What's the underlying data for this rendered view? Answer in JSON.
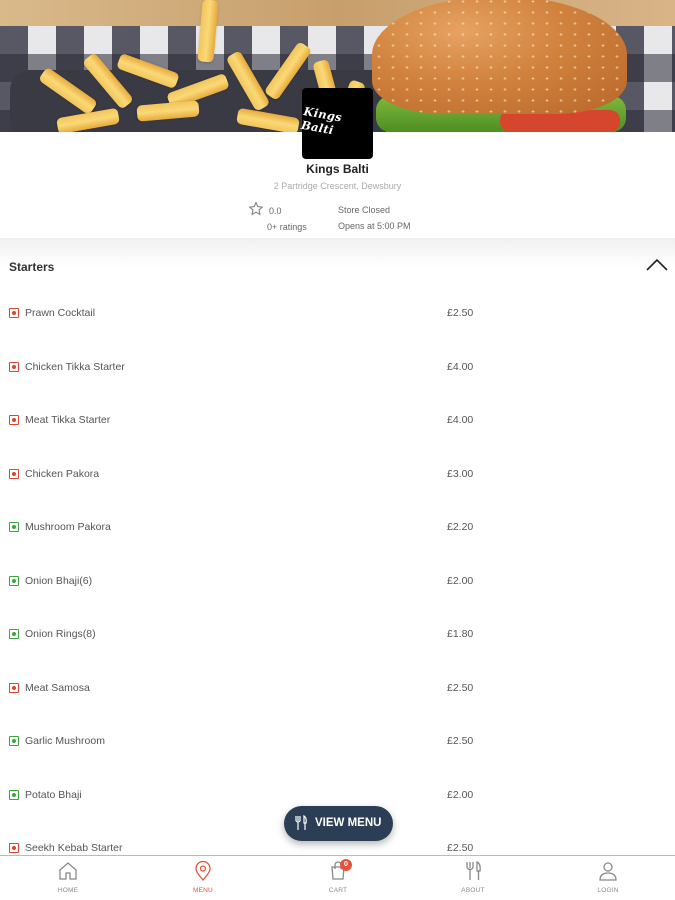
{
  "store": {
    "logo_text": "Kings Balti",
    "name": "Kings Balti",
    "address": "2 Partridge Crescent, Dewsbury",
    "rating": "0.0",
    "ratings_count": "0+ ratings",
    "status": "Store Closed",
    "hours": "Opens at 5:00 PM"
  },
  "section": {
    "title": "Starters",
    "expanded": true
  },
  "menu_items": [
    {
      "name": "Prawn Cocktail",
      "price": "£2.50",
      "diet": "non-veg"
    },
    {
      "name": "Chicken Tikka Starter",
      "price": "£4.00",
      "diet": "non-veg"
    },
    {
      "name": "Meat Tikka Starter",
      "price": "£4.00",
      "diet": "non-veg"
    },
    {
      "name": "Chicken Pakora",
      "price": "£3.00",
      "diet": "non-veg"
    },
    {
      "name": "Mushroom Pakora",
      "price": "£2.20",
      "diet": "veg"
    },
    {
      "name": "Onion Bhaji(6)",
      "price": "£2.00",
      "diet": "veg"
    },
    {
      "name": "Onion Rings(8)",
      "price": "£1.80",
      "diet": "veg"
    },
    {
      "name": "Meat Samosa",
      "price": "£2.50",
      "diet": "non-veg"
    },
    {
      "name": "Garlic Mushroom",
      "price": "£2.50",
      "diet": "veg"
    },
    {
      "name": "Potato Bhaji",
      "price": "£2.00",
      "diet": "veg"
    },
    {
      "name": "Seekh Kebab Starter",
      "price": "£2.50",
      "diet": "non-veg"
    }
  ],
  "view_menu_button": {
    "label": "VIEW MENU",
    "icon": "cutlery-icon"
  },
  "bottom_nav": {
    "home": {
      "label": "HOME",
      "icon": "home-icon"
    },
    "menu": {
      "label": "MENU",
      "icon": "location-pin-icon",
      "active": true
    },
    "cart": {
      "label": "CART",
      "icon": "cart-icon",
      "badge": "0"
    },
    "about": {
      "label": "ABOUT",
      "icon": "cutlery-icon"
    },
    "login": {
      "label": "LOGIN",
      "icon": "user-icon"
    }
  },
  "colors": {
    "accent": "#e2553a",
    "fab": "#2c3e55",
    "non_veg": "#d9452e",
    "veg": "#3ba83b"
  }
}
